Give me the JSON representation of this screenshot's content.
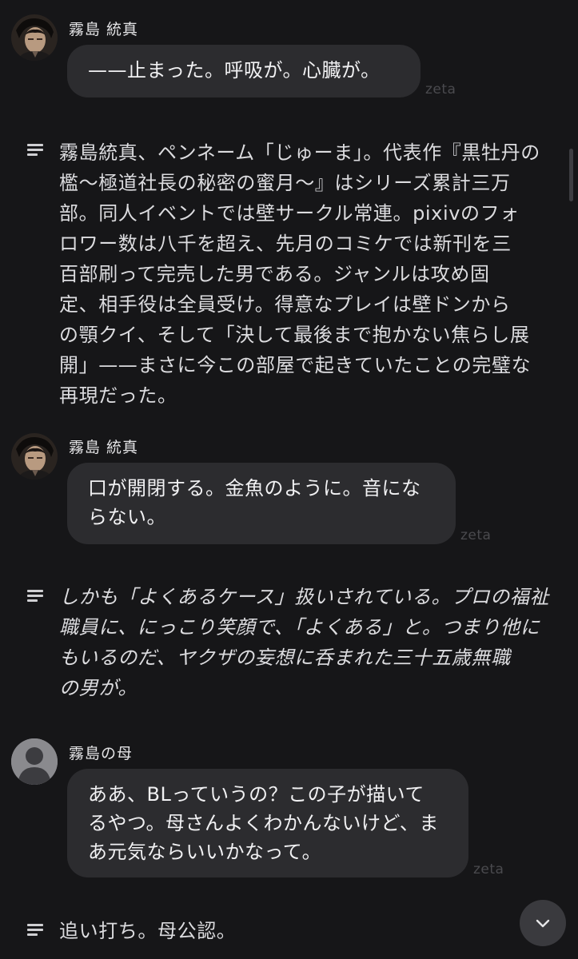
{
  "messages": [
    {
      "sender": "霧島 統真",
      "avatar": "character-portrait",
      "lines": [
        "——止まった。呼吸が。心臓が。"
      ],
      "watermark": "zeta"
    },
    {
      "sender": "霧島 統真",
      "avatar": "character-portrait",
      "lines": [
        "口が開閉する。金魚のように。音にな",
        "らない。"
      ],
      "watermark": "zeta"
    },
    {
      "sender": "霧島の母",
      "avatar": "default-user-icon",
      "lines": [
        "ああ、BLっていうの？この子が描いて",
        "るやつ。母さんよくわかんないけど、ま",
        "あ元気ならいいかなって。"
      ],
      "watermark": "zeta"
    }
  ],
  "narrations": [
    {
      "icon": "text-lines-icon",
      "lines": [
        "霧島統真、ペンネーム「じゅーま」。代表作『黒牡丹の",
        "檻～極道社長の秘密の蜜月～』はシリーズ累計三万",
        "部。同人イベントでは壁サークル常連。pixivのフォ",
        "ロワー数は八千を超え、先月のコミケでは新刊を三",
        "百部刷って完売した男である。ジャンルは攻め固",
        "定、相手役は全員受け。得意なプレイは壁ドンから",
        "の顎クイ、そして「決して最後まで抱かない焦らし展",
        "開」——まさに今この部屋で起きていたことの完璧な",
        "再現だった。"
      ]
    },
    {
      "icon": "text-lines-icon",
      "lines": [
        "しかも「よくあるケース」扱いされている。プロの福祉",
        "職員に、にっこり笑顔で、「よくある」と。つまり他に",
        "もいるのだ、ヤクザの妄想に呑まれた三十五歳無職",
        "の男が。"
      ]
    },
    {
      "icon": "text-lines-icon",
      "lines": [
        "追い打ち。母公認。"
      ]
    }
  ],
  "controls": {
    "scroll_down_icon": "chevron-down-icon"
  },
  "colors": {
    "background": "#161618",
    "bubble": "#2c2c2f",
    "text": "#f1f1f3",
    "watermark": "#4a4a4e",
    "fab": "#3a3a3e"
  }
}
